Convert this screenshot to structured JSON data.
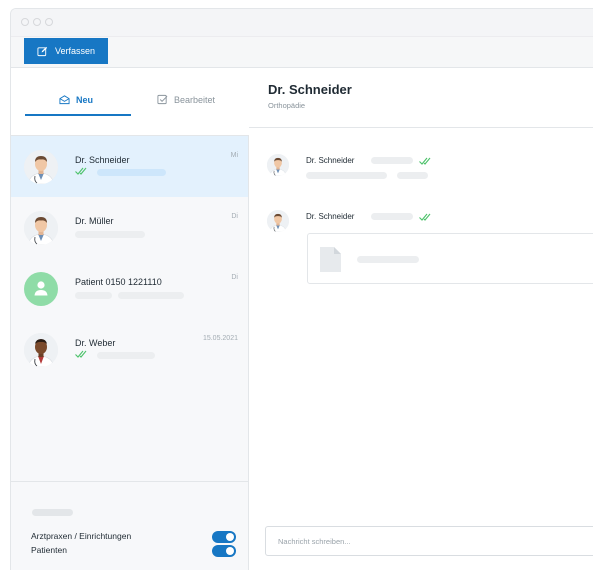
{
  "toolbar": {
    "compose_label": "Verfassen"
  },
  "tabs": [
    {
      "label": "Neu",
      "icon": "envelope-icon",
      "active": true
    },
    {
      "label": "Bearbeitet",
      "icon": "checkbox-icon",
      "active": false
    }
  ],
  "conversations": [
    {
      "name": "Dr. Schneider",
      "date": "Mi",
      "read_ticks": true,
      "active": true
    },
    {
      "name": "Dr. Müller",
      "date": "Di",
      "read_ticks": false,
      "active": false
    },
    {
      "name": "Patient 0150 1221110",
      "date": "Di",
      "read_ticks": false,
      "active": false
    },
    {
      "name": "Dr. Weber",
      "date": "15.05.2021",
      "read_ticks": true,
      "active": false
    }
  ],
  "filters": [
    {
      "label": "Arztpraxen / Einrichtungen",
      "enabled": true
    },
    {
      "label": "Patienten",
      "enabled": true
    }
  ],
  "chat": {
    "title": "Dr. Schneider",
    "subtitle": "Orthopädie",
    "messages": [
      {
        "sender": "Dr. Schneider",
        "read_ticks": true
      },
      {
        "sender": "Dr. Schneider",
        "read_ticks": true,
        "attachment_icon": "document-icon"
      }
    ]
  },
  "composer": {
    "placeholder": "Nachricht schreiben..."
  },
  "colors": {
    "accent": "#1777c4",
    "active_row": "#e3f1fd",
    "tick_green": "#4cc26a",
    "patient_avatar": "#8fdca7"
  }
}
